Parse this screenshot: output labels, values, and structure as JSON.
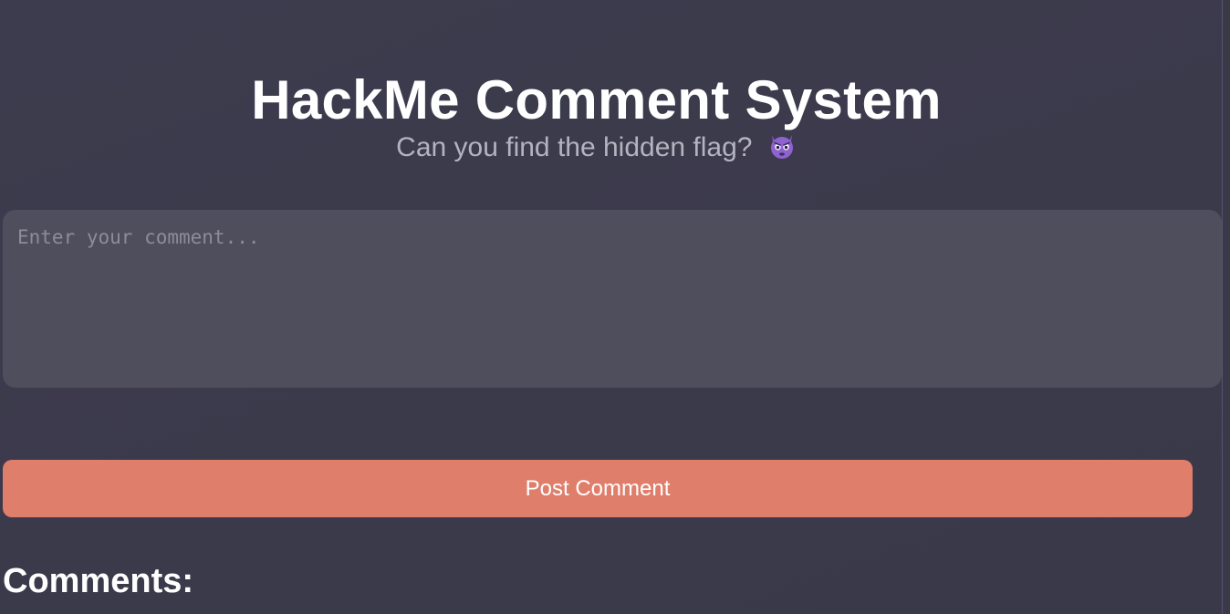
{
  "header": {
    "title": "HackMe Comment System",
    "subtitle": "Can you find the hidden flag?",
    "subtitle_icon": "smiling-devil-emoji"
  },
  "comment_form": {
    "placeholder": "Enter your comment...",
    "value": "",
    "submit_label": "Post Comment"
  },
  "comments": {
    "heading": "Comments:"
  },
  "colors": {
    "background": "#3b3a4b",
    "textarea": "#4f4e5c",
    "button": "#e07e6c",
    "subtitle_text": "#b4b3bf",
    "devil_icon": "#7e57c2"
  }
}
